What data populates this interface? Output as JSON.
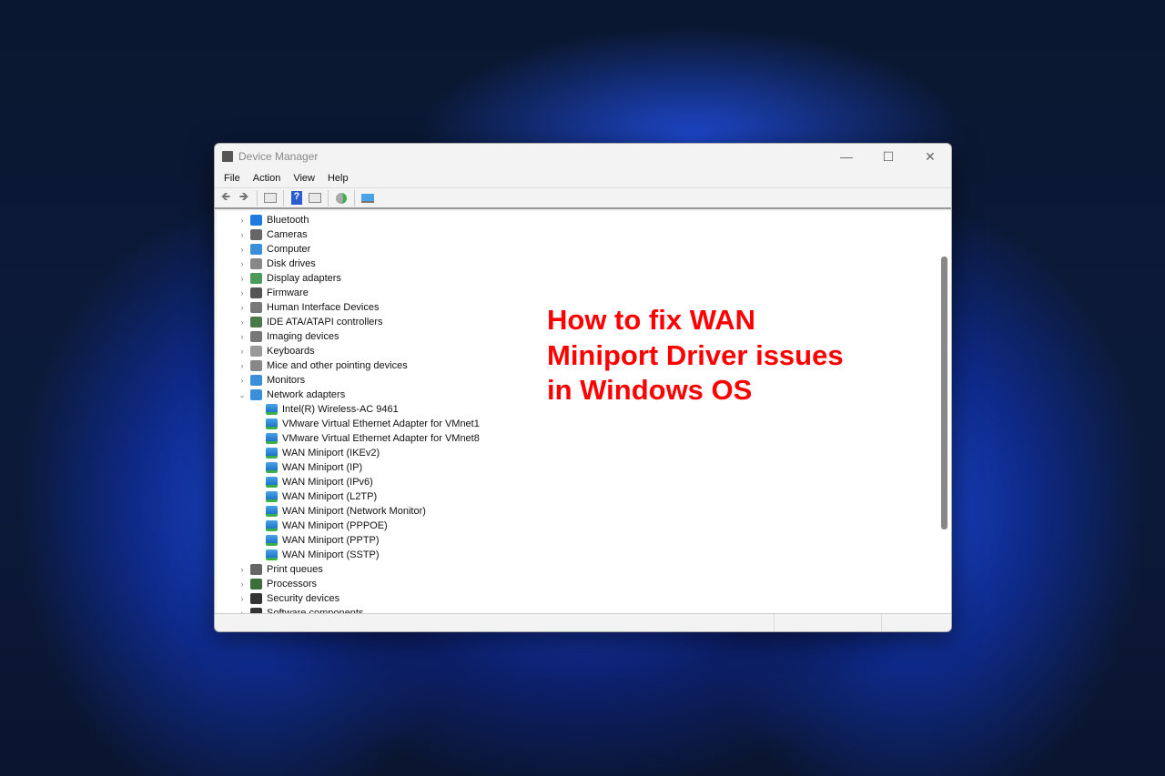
{
  "window": {
    "title": "Device Manager",
    "minimize": "—",
    "maximize": "☐",
    "close": "✕"
  },
  "menu": [
    "File",
    "Action",
    "View",
    "Help"
  ],
  "toolbar": {
    "back": "🡸",
    "forward": "🡺",
    "help": "?"
  },
  "tree": [
    {
      "label": "Bluetooth",
      "icon": "bluetooth-icon",
      "color": "#1e7be0",
      "expanded": false
    },
    {
      "label": "Cameras",
      "icon": "camera-icon",
      "color": "#666666",
      "expanded": false
    },
    {
      "label": "Computer",
      "icon": "computer-icon",
      "color": "#3a8fd8",
      "expanded": false
    },
    {
      "label": "Disk drives",
      "icon": "disk-icon",
      "color": "#888888",
      "expanded": false
    },
    {
      "label": "Display adapters",
      "icon": "display-adapter-icon",
      "color": "#4a9a5a",
      "expanded": false
    },
    {
      "label": "Firmware",
      "icon": "firmware-icon",
      "color": "#555555",
      "expanded": false
    },
    {
      "label": "Human Interface Devices",
      "icon": "hid-icon",
      "color": "#777777",
      "expanded": false
    },
    {
      "label": "IDE ATA/ATAPI controllers",
      "icon": "ide-icon",
      "color": "#4a7a4a",
      "expanded": false
    },
    {
      "label": "Imaging devices",
      "icon": "imaging-icon",
      "color": "#777777",
      "expanded": false
    },
    {
      "label": "Keyboards",
      "icon": "keyboard-icon",
      "color": "#999999",
      "expanded": false
    },
    {
      "label": "Mice and other pointing devices",
      "icon": "mouse-icon",
      "color": "#888888",
      "expanded": false
    },
    {
      "label": "Monitors",
      "icon": "monitor-icon",
      "color": "#3a8fd8",
      "expanded": false
    },
    {
      "label": "Network adapters",
      "icon": "network-adapter-icon",
      "color": "#3a8fd8",
      "expanded": true,
      "children": [
        "Intel(R) Wireless-AC 9461",
        "VMware Virtual Ethernet Adapter for VMnet1",
        "VMware Virtual Ethernet Adapter for VMnet8",
        "WAN Miniport (IKEv2)",
        "WAN Miniport (IP)",
        "WAN Miniport (IPv6)",
        "WAN Miniport (L2TP)",
        "WAN Miniport (Network Monitor)",
        "WAN Miniport (PPPOE)",
        "WAN Miniport (PPTP)",
        "WAN Miniport (SSTP)"
      ]
    },
    {
      "label": "Print queues",
      "icon": "printer-icon",
      "color": "#666666",
      "expanded": false
    },
    {
      "label": "Processors",
      "icon": "processor-icon",
      "color": "#3c6e3c",
      "expanded": false
    },
    {
      "label": "Security devices",
      "icon": "security-icon",
      "color": "#333333",
      "expanded": false
    },
    {
      "label": "Software components",
      "icon": "software-icon",
      "color": "#333333",
      "expanded": false
    }
  ],
  "overlay": {
    "lines": [
      "How to fix WAN",
      "Miniport Driver issues",
      "in Windows OS"
    ],
    "color": "#ff0000"
  }
}
